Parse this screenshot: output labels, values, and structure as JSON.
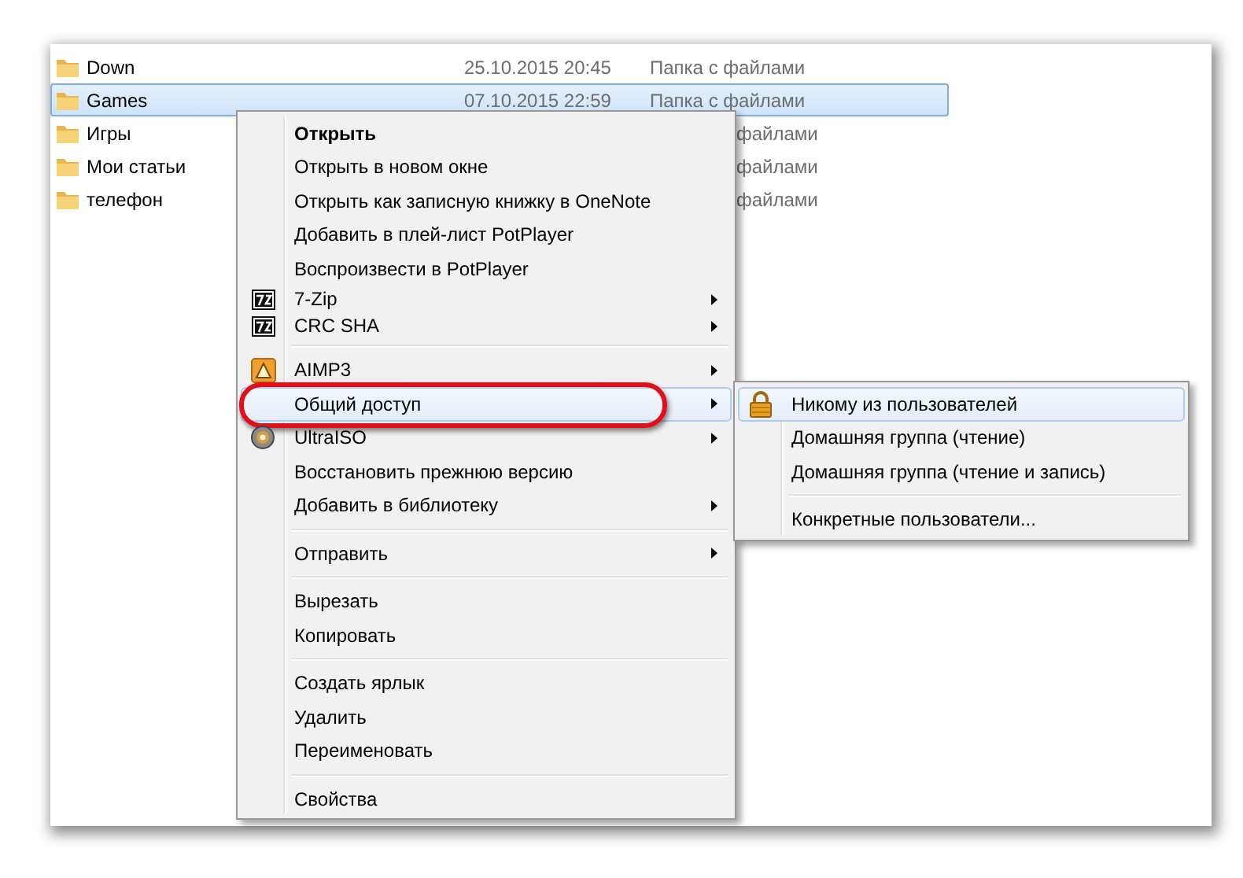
{
  "files": [
    {
      "name": "Down",
      "date": "25.10.2015 20:45",
      "type": "Папка с файлами",
      "selected": false
    },
    {
      "name": "Games",
      "date": "07.10.2015 22:59",
      "type": "Папка с файлами",
      "selected": true
    },
    {
      "name": "Игры",
      "type": "файлами",
      "selected": false
    },
    {
      "name": "Мои статьи",
      "type": "файлами",
      "selected": false
    },
    {
      "name": "телефон",
      "type": "файлами",
      "selected": false
    }
  ],
  "context_menu": {
    "items": [
      {
        "kind": "command",
        "label": "Открыть",
        "default": true,
        "submenu": false,
        "hovered": false,
        "circled": false
      },
      {
        "kind": "command",
        "label": "Открыть в новом окне",
        "default": false,
        "submenu": false,
        "hovered": false,
        "circled": false
      },
      {
        "kind": "command",
        "label": "Открыть как записную книжку в OneNote",
        "default": false,
        "submenu": false,
        "hovered": false,
        "circled": false
      },
      {
        "kind": "command",
        "label": "Добавить в плей-лист PotPlayer",
        "default": false,
        "submenu": false,
        "hovered": false,
        "circled": false
      },
      {
        "kind": "command",
        "label": "Воспроизвести в PotPlayer",
        "default": false,
        "submenu": false,
        "hovered": false,
        "circled": false
      },
      {
        "kind": "archive",
        "label": "7-Zip",
        "default": false,
        "submenu": true,
        "hovered": false,
        "circled": false
      },
      {
        "kind": "archive",
        "label": "CRC SHA",
        "default": false,
        "submenu": true,
        "hovered": false,
        "circled": false
      },
      {
        "kind": "separator"
      },
      {
        "kind": "player",
        "label": "AIMP3",
        "default": false,
        "submenu": true,
        "hovered": false,
        "circled": false
      },
      {
        "kind": "command",
        "label": "Общий доступ",
        "default": false,
        "submenu": true,
        "hovered": true,
        "circled": true
      },
      {
        "kind": "disc",
        "label": "UltraISO",
        "default": false,
        "submenu": true,
        "hovered": false,
        "circled": false
      },
      {
        "kind": "command",
        "label": "Восстановить прежнюю версию",
        "default": false,
        "submenu": false,
        "hovered": false,
        "circled": false
      },
      {
        "kind": "command",
        "label": "Добавить в библиотеку",
        "default": false,
        "submenu": true,
        "hovered": false,
        "circled": false
      },
      {
        "kind": "separator"
      },
      {
        "kind": "command",
        "label": "Отправить",
        "default": false,
        "submenu": true,
        "hovered": false,
        "circled": false
      },
      {
        "kind": "separator"
      },
      {
        "kind": "command",
        "label": "Вырезать",
        "default": false,
        "submenu": false,
        "hovered": false,
        "circled": false
      },
      {
        "kind": "command",
        "label": "Копировать",
        "default": false,
        "submenu": false,
        "hovered": false,
        "circled": false
      },
      {
        "kind": "separator"
      },
      {
        "kind": "command",
        "label": "Создать ярлык",
        "default": false,
        "submenu": false,
        "hovered": false,
        "circled": false
      },
      {
        "kind": "command",
        "label": "Удалить",
        "default": false,
        "submenu": false,
        "hovered": false,
        "circled": false
      },
      {
        "kind": "command",
        "label": "Переименовать",
        "default": false,
        "submenu": false,
        "hovered": false,
        "circled": false
      },
      {
        "kind": "separator"
      },
      {
        "kind": "command",
        "label": "Свойства",
        "default": false,
        "submenu": false,
        "hovered": false,
        "circled": false
      }
    ]
  },
  "sharing_submenu": {
    "items": [
      {
        "kind": "lock",
        "label": "Никому из пользователей",
        "default": false,
        "submenu": false,
        "hovered": true,
        "circled": false
      },
      {
        "kind": "command",
        "label": "Домашняя группа (чтение)",
        "default": false,
        "submenu": false,
        "hovered": false,
        "circled": false
      },
      {
        "kind": "command",
        "label": "Домашняя группа (чтение и запись)",
        "default": false,
        "submenu": false,
        "hovered": false,
        "circled": false
      },
      {
        "kind": "separator"
      },
      {
        "kind": "command",
        "label": "Конкретные пользователи...",
        "default": false,
        "submenu": false,
        "hovered": false,
        "circled": false
      }
    ]
  }
}
